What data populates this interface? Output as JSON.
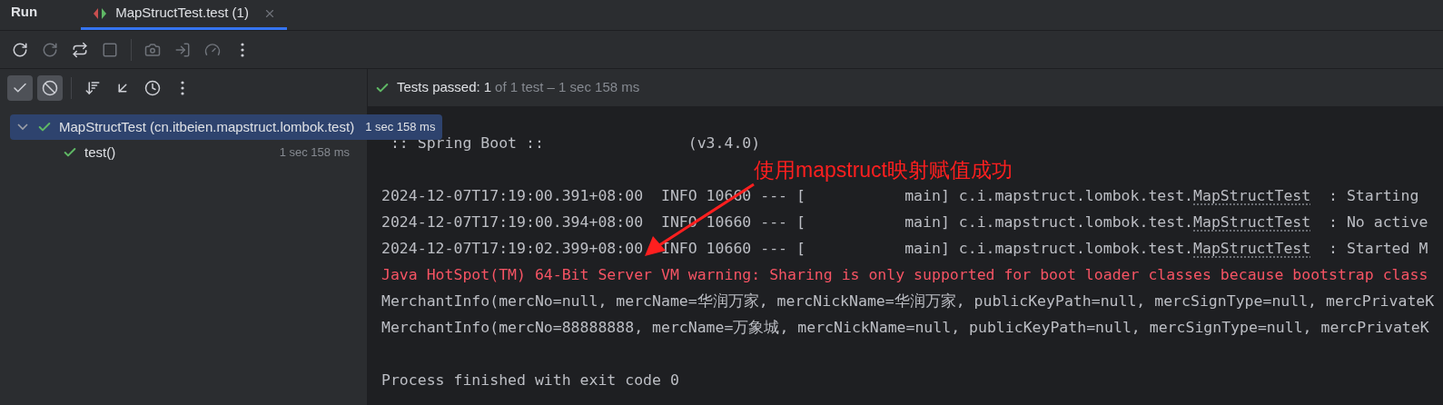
{
  "panel": {
    "title": "Run"
  },
  "tabs": [
    {
      "label": "MapStructTest.test (1)",
      "selected": true
    }
  ],
  "toolbar": [
    {
      "kind": "rerun",
      "disabled": false
    },
    {
      "kind": "rerun-failed",
      "disabled": true
    },
    {
      "kind": "toggle-rerun",
      "disabled": false
    },
    {
      "kind": "stop",
      "disabled": true
    },
    {
      "kind": "separator"
    },
    {
      "kind": "screenshot",
      "disabled": true
    },
    {
      "kind": "import",
      "disabled": true
    },
    {
      "kind": "profile",
      "disabled": true
    },
    {
      "kind": "more",
      "disabled": false
    }
  ],
  "filter_toolbar": [
    {
      "kind": "show-passed",
      "selected": true
    },
    {
      "kind": "show-ignored",
      "selected": true
    },
    {
      "kind": "separator"
    },
    {
      "kind": "sort",
      "selected": false
    },
    {
      "kind": "collapse",
      "selected": false
    },
    {
      "kind": "history",
      "selected": false
    },
    {
      "kind": "more",
      "selected": false
    }
  ],
  "status": {
    "label": "Tests passed:",
    "count": "1",
    "detail": "of 1 test – 1 sec 158 ms"
  },
  "test_tree": [
    {
      "label": "MapStructTest (cn.itbeien.mapstruct.lombok.test)",
      "time": "1 sec 158 ms",
      "expanded": true,
      "selected": true,
      "children": [
        {
          "label": "test()",
          "time": "1 sec 158 ms",
          "selected": false
        }
      ]
    }
  ],
  "console": [
    {
      "kind": "banner",
      "text": " :: Spring Boot ::                (v3.4.0)"
    },
    {
      "kind": "blank"
    },
    {
      "kind": "log",
      "text": "2024-12-07T17:19:00.391+08:00  INFO 10660 --- [           main] c.i.mapstruct.lombok.test.",
      "link": "MapStructTest",
      "rest": "  : Starting"
    },
    {
      "kind": "log",
      "text": "2024-12-07T17:19:00.394+08:00  INFO 10660 --- [           main] c.i.mapstruct.lombok.test.",
      "link": "MapStructTest",
      "rest": "  : No active"
    },
    {
      "kind": "log",
      "text": "2024-12-07T17:19:02.399+08:00  INFO 10660 --- [           main] c.i.mapstruct.lombok.test.",
      "link": "MapStructTest",
      "rest": "  : Started M"
    },
    {
      "kind": "error",
      "text": "Java HotSpot(TM) 64-Bit Server VM warning: Sharing is only supported for boot loader classes because bootstrap class"
    },
    {
      "kind": "output",
      "text": "MerchantInfo(mercNo=null, mercName=华润万家, mercNickName=华润万家, publicKeyPath=null, mercSignType=null, mercPrivateK"
    },
    {
      "kind": "output",
      "text": "MerchantInfo(mercNo=88888888, mercName=万象城, mercNickName=null, publicKeyPath=null, mercSignType=null, mercPrivateK"
    },
    {
      "kind": "blank"
    },
    {
      "kind": "output",
      "text": "Process finished with exit code 0"
    }
  ],
  "annotation": {
    "text": "使用mapstruct映射赋值成功"
  }
}
